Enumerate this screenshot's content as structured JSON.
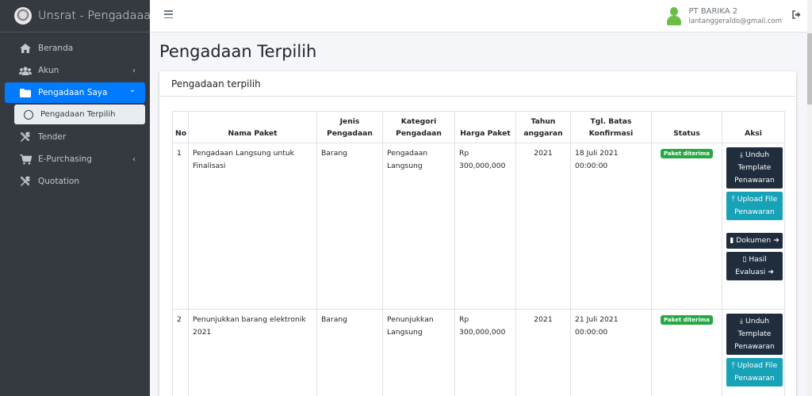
{
  "app": {
    "brand": "Unsrat - Pengadaaan Ba"
  },
  "sidebar": {
    "items": [
      {
        "label": "Beranda",
        "icon": "home-icon"
      },
      {
        "label": "Akun",
        "icon": "users-icon",
        "arrow": "‹"
      },
      {
        "label": "Pengadaan Saya",
        "icon": "folder-icon",
        "arrow": "⌄",
        "active": true
      },
      {
        "label": "Tender",
        "icon": "tools-icon"
      },
      {
        "label": "E-Purchasing",
        "icon": "cart-icon",
        "arrow": "‹"
      },
      {
        "label": "Quotation",
        "icon": "tools-icon"
      }
    ],
    "subitem": "Pengadaan Terpilih"
  },
  "header": {
    "user_name": "PT BARIKA 2",
    "user_email": "lantanggeraldo@gmail.com"
  },
  "page": {
    "title": "Pengadaan Terpilih",
    "card_title": "Pengadaan terpilih"
  },
  "table": {
    "headers": [
      "No",
      "Nama Paket",
      "Jenis Pengadaan",
      "Kategori Pengadaan",
      "Harga Paket",
      "Tahun anggaran",
      "Tgl. Batas Konfirmasi",
      "Status",
      "Aksi"
    ],
    "rows": [
      {
        "no": "1",
        "nama": "Pengadaan Langsung untuk Finalisasi",
        "jenis": "Barang",
        "kategori": "Pengadaan Langsung",
        "harga": "Rp 300,000,000",
        "tahun": "2021",
        "batas": "18 Juli 2021 00:00:00",
        "status": "Paket diterima"
      },
      {
        "no": "2",
        "nama": "Penunjukkan barang elektronik 2021",
        "jenis": "Barang",
        "kategori": "Penunjukkan Langsung",
        "harga": "Rp 300,000,000",
        "tahun": "2021",
        "batas": "21 Juli 2021 00:00:00",
        "status": "Paket diterima"
      }
    ],
    "actions": {
      "unduh": "Unduh Template Penawaran",
      "upload": "Upload File Penawaran",
      "dokumen": "Dokumen",
      "hasil": "Hasil Evaluasi"
    }
  },
  "colors": {
    "sidebar_bg": "#343a40",
    "active": "#007bff",
    "success": "#28a745",
    "dark_button": "#1f2d3d",
    "info_button": "#17a2b8"
  }
}
